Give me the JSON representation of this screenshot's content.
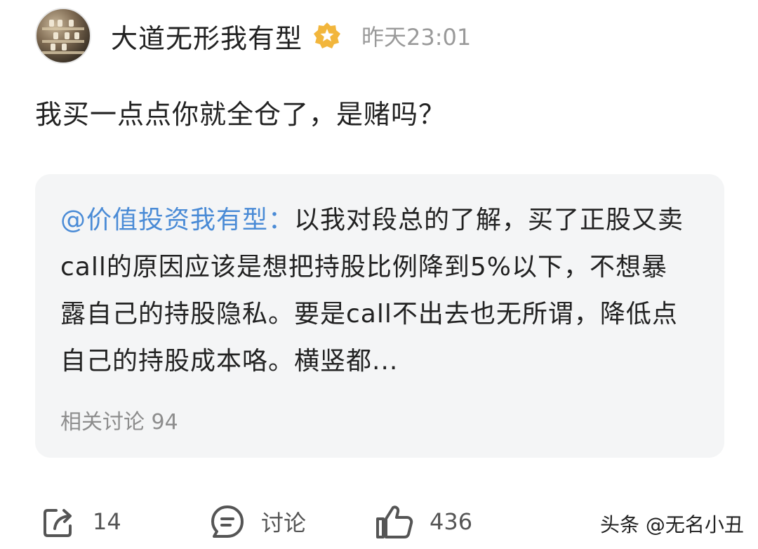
{
  "post": {
    "author": "大道无形我有型",
    "badge_icon": "vip-star-badge-icon",
    "time": "昨天23:01",
    "text": "我买一点点你就全仓了，是赌吗？"
  },
  "quote": {
    "mention": "@价值投资我有型：",
    "body": "以我对段总的了解，买了正股又卖call的原因应该是想把持股比例降到5%以下，不想暴露自己的持股隐私。要是call不出去也无所谓，降低点自己的持股成本咯。横竖都...",
    "related": "相关讨论 94"
  },
  "actions": {
    "share": {
      "icon": "share-icon",
      "count": "14"
    },
    "comment": {
      "icon": "comment-icon",
      "label": "讨论"
    },
    "like": {
      "icon": "thumbs-up-icon",
      "count": "436"
    }
  },
  "watermark": "头条 @无名小丑",
  "colors": {
    "mention": "#4a8bd6",
    "card_bg": "#f4f5f6",
    "badge": "#f2b63c"
  }
}
